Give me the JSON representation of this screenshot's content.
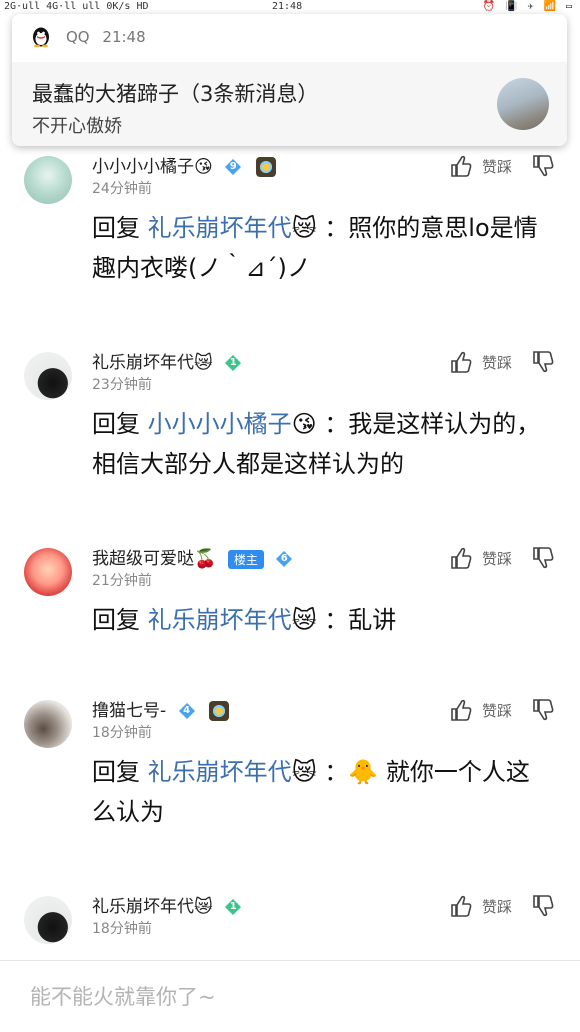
{
  "statusbar": {
    "left": "2G·ull 4G·ll ull 0K/s HD",
    "center": "21:48",
    "right": "⏰ 📳 ✈ 📶 ▭"
  },
  "notification": {
    "app": "QQ",
    "time": "21:48",
    "title": "最蠢的大猪蹄子（3条新消息）",
    "message": "不开心傲娇"
  },
  "comments": [
    {
      "user": "小小小小橘子",
      "user_emoji": "😘",
      "level": "9",
      "time": "24分钟前",
      "reply_prefix": "回复",
      "mention": "礼乐崩坏年代",
      "mention_emoji": "😿",
      "text": "：照你的意思lo是情趣内衣喽(ノ｀⊿´)ノ"
    },
    {
      "user": "礼乐崩坏年代",
      "user_emoji": "😿",
      "level": "1",
      "time": "23分钟前",
      "reply_prefix": "回复",
      "mention": "小小小小橘子",
      "mention_emoji": "😘",
      "text": "：我是这样认为的，相信大部分人都是这样认为的"
    },
    {
      "user": "我超级可爱哒",
      "user_emoji": "🍒",
      "floor_tag": "楼主",
      "level": "6",
      "time": "21分钟前",
      "reply_prefix": "回复",
      "mention": "礼乐崩坏年代",
      "mention_emoji": "😿",
      "text": "：乱讲"
    },
    {
      "user": "撸猫七号-",
      "level": "4",
      "time": "18分钟前",
      "reply_prefix": "回复",
      "mention": "礼乐崩坏年代",
      "mention_emoji": "😿",
      "inline_emoji": "🐥",
      "text": "：🐥 就你一个人这么认为"
    },
    {
      "user": "礼乐崩坏年代",
      "user_emoji": "😿",
      "level": "1",
      "time": "18分钟前"
    }
  ],
  "actions": {
    "like": "赞",
    "dislike": "踩"
  },
  "input": {
    "placeholder": "能不能火就靠你了~"
  },
  "colors": {
    "mention": "#3b6fae",
    "diamond": "#4aa3f0",
    "green_diamond": "#3cc48a",
    "floor_tag": "#2f8cf0"
  }
}
